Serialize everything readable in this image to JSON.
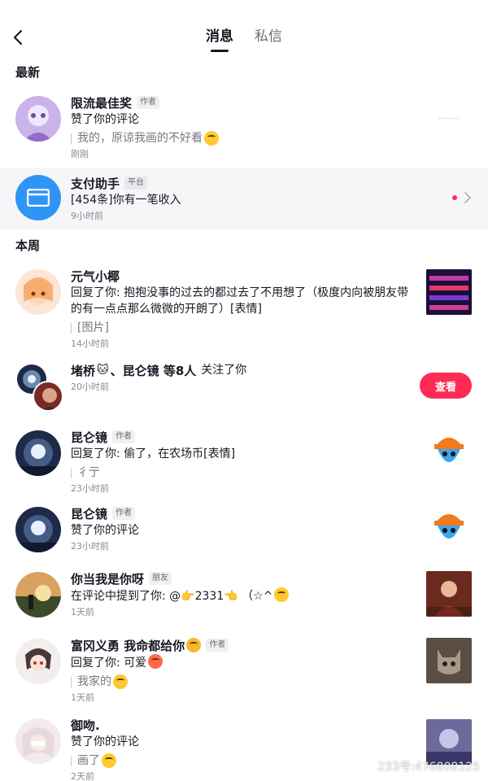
{
  "header": {
    "tabs": [
      {
        "label": "消息",
        "active": true
      },
      {
        "label": "私信",
        "active": false
      }
    ]
  },
  "sections": {
    "latest": "最新",
    "this_week": "本周"
  },
  "items": [
    {
      "name": "限流最佳奖",
      "tag": "作者",
      "line": "赞了你的评论",
      "quote": "我的，原谅我画的不好看",
      "time": "刚刚",
      "thumb_text": "· · · · · ·"
    },
    {
      "name": "支付助手",
      "tag": "平台",
      "line": "[454条]你有一笔收入",
      "time": "9小时前"
    },
    {
      "name": "元气小椰",
      "line1": "回复了你: 抱抱没事的过去的都过去了不用想了（极度内向被朋友带",
      "line2": "的有一点点那么微微的开朗了）[表情]",
      "quote": "[图片]",
      "time": "14小时前"
    },
    {
      "name": "堵桥",
      "name_rest": "、昆仑镜 等8人",
      "action": "关注了你",
      "time": "20小时前",
      "button": "查看"
    },
    {
      "name": "昆仑镜",
      "tag": "作者",
      "line": "回复了你: 偷了，在农场币[表情]",
      "quote": "彳亍",
      "time": "23小时前"
    },
    {
      "name": "昆仑镜",
      "tag": "作者",
      "line": "赞了你的评论",
      "time": "23小时前"
    },
    {
      "name": "你当我是你呀",
      "tag": "朋友",
      "line": "在评论中提到了你: @",
      "line_suffix": "2331",
      "line_tail": "（☆^",
      "time": "1天前"
    },
    {
      "name": "富冈义勇 我命都给你",
      "tag": "作者",
      "line": "回复了你: 可爱",
      "quote": "我家的",
      "time": "1天前"
    },
    {
      "name": "御吻.",
      "line": "赞了你的评论",
      "quote": "画了",
      "time": "2天前"
    }
  ],
  "watermark": "233号:476808125",
  "colors": {
    "accent": "#fe2c55",
    "assistant_bg": "#f6f6f8",
    "assistant_icon": "#2f95f5"
  }
}
